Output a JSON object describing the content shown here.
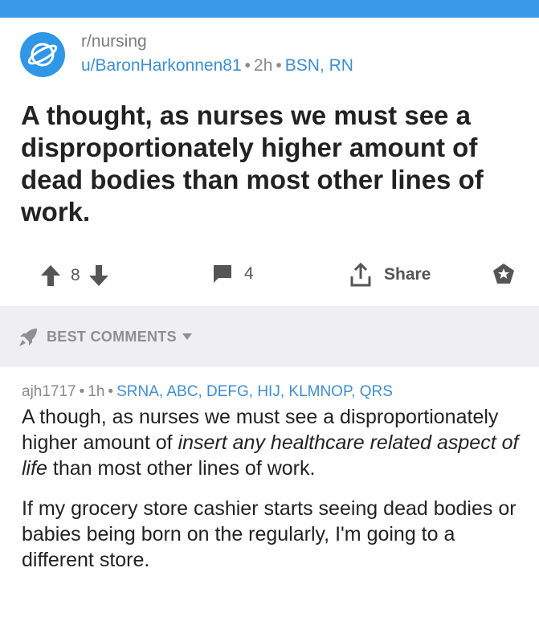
{
  "post": {
    "subreddit": "r/nursing",
    "author": "u/BaronHarkonnen81",
    "time": "2h",
    "flair": "BSN, RN",
    "title": "A thought, as nurses we must see a disproportionately higher amount of dead bodies than most other lines of work.",
    "score": "8",
    "comment_count": "4",
    "share_label": "Share"
  },
  "sort": {
    "label": "BEST COMMENTS"
  },
  "comment": {
    "author": "ajh1717",
    "time": "1h",
    "flair": "SRNA, ABC, DEFG, HIJ, KLMNOP, QRS",
    "p1_part1": "A though, as nurses we must see a disproportionately higher amount of ",
    "p1_italic": "insert any healthcare related aspect of life",
    "p1_part2": " than most other lines of work.",
    "p2": "If my grocery store cashier starts seeing dead bodies or babies being born on the regularly, I'm going to a different store."
  },
  "colors": {
    "accent_blue": "#3b9ae8",
    "link_blue": "#3e8ed0",
    "sort_bar_bg": "#efeff1"
  }
}
